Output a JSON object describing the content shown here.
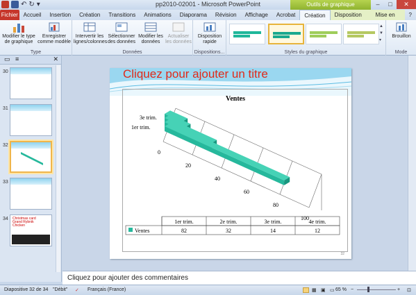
{
  "window": {
    "title": "pp2010-02001  -  Microsoft PowerPoint",
    "contextual_group": "Outils de graphique"
  },
  "tabs": [
    "Fichier",
    "Accueil",
    "Insertion",
    "Création",
    "Transitions",
    "Animations",
    "Diaporama",
    "Révision",
    "Affichage",
    "Acrobat",
    "Création",
    "Disposition",
    "Mise en forme"
  ],
  "ribbon": {
    "groups": {
      "type": "Type",
      "donnees": "Données",
      "dispositions": "Dispositions...",
      "styles": "Styles du graphique",
      "mode": "Mode"
    },
    "buttons": {
      "modifier_type": "Modifier le type de graphique",
      "enregistrer_modele": "Enregistrer comme modèle",
      "intervertir": "Intervertir les lignes/colonnes",
      "selectionner": "Sélectionner des données",
      "modifier_donnees": "Modifier les données",
      "actualiser": "Actualiser les données",
      "disposition_rapide": "Disposition rapide",
      "brouillon": "Brouillon"
    }
  },
  "thumbnails": [
    {
      "num": "30"
    },
    {
      "num": "31"
    },
    {
      "num": "32"
    },
    {
      "num": "33"
    },
    {
      "num": "34",
      "text": "Christmas card Grand Rybnik Chicken"
    }
  ],
  "slide": {
    "title_placeholder": "Cliquez pour ajouter un titre",
    "page_number": "32"
  },
  "chart_data": {
    "type": "bar",
    "title": "Ventes",
    "categories": [
      "1er trim.",
      "2e trim.",
      "3e trim.",
      "4e trim."
    ],
    "series": [
      {
        "name": "Ventes",
        "values": [
          82,
          32,
          14,
          12
        ]
      }
    ],
    "axis_ticks": [
      "0",
      "20",
      "40",
      "60",
      "80",
      "100"
    ],
    "visible_category_labels": [
      "3e trim.",
      "1er trim."
    ],
    "data_table": true,
    "color": "#26b89c"
  },
  "notes": {
    "placeholder": "Cliquez pour ajouter des commentaires"
  },
  "status": {
    "slide_info": "Diapositive 32 de 34",
    "theme": "\"Débit\"",
    "language": "Français (France)",
    "zoom": "65 %"
  }
}
